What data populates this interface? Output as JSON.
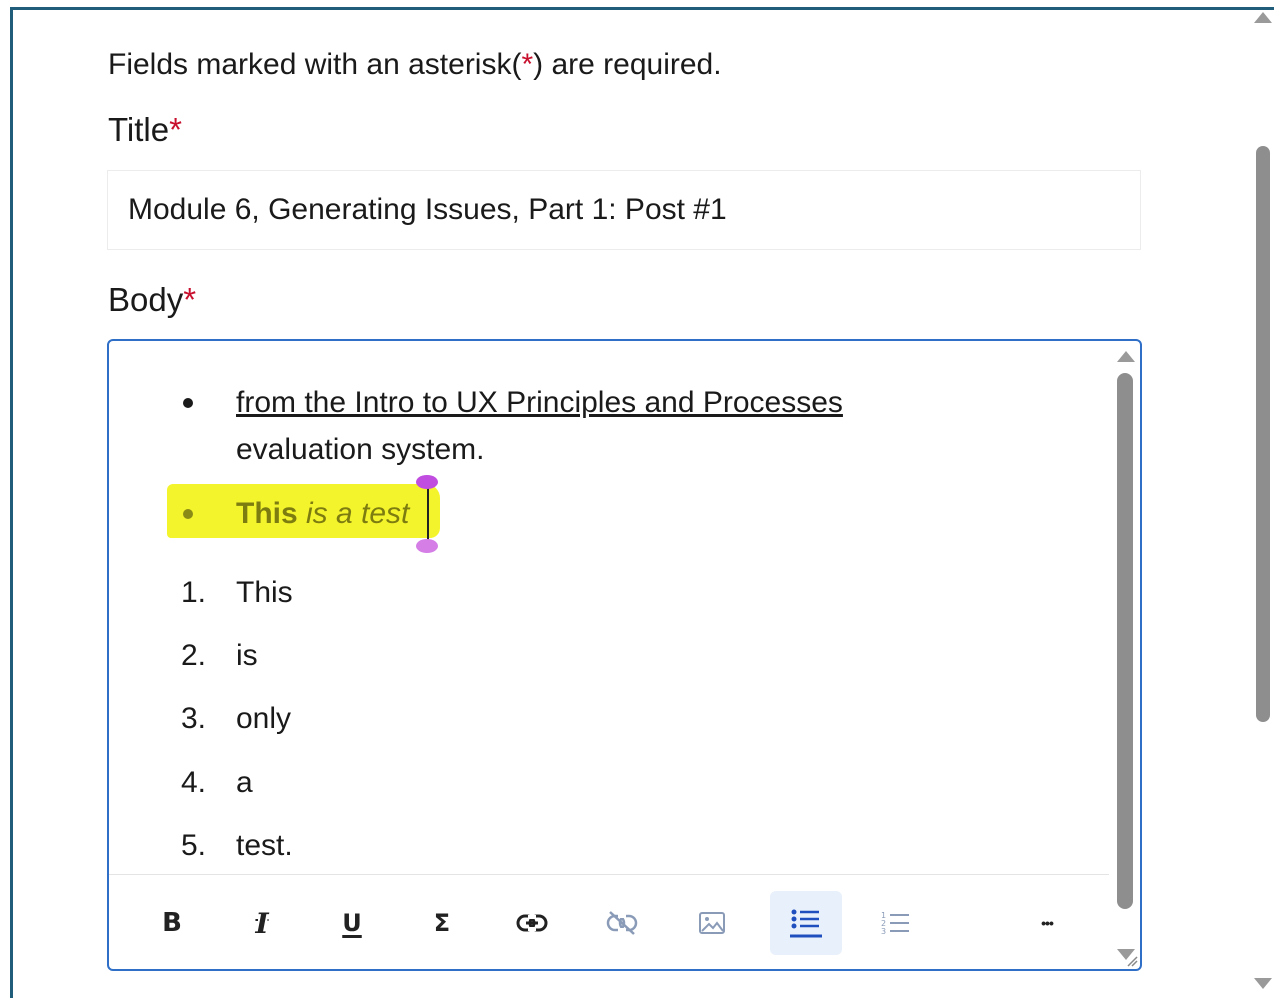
{
  "form": {
    "required_note_prefix": "Fields marked with an asterisk(",
    "required_note_star": "*",
    "required_note_suffix": ") are required.",
    "title_label": "Title",
    "title_star": "*",
    "title_value": "Module 6, Generating Issues, Part 1: Post #1",
    "body_label": "Body",
    "body_star": "*"
  },
  "editor": {
    "bullet_1_link": "from the Intro to UX Principles and Processes",
    "bullet_1_rest": "evaluation system.",
    "bullet_2_bold": "This",
    "bullet_2_italic": " is a test",
    "numbered_items": [
      {
        "num": "1.",
        "text": "This"
      },
      {
        "num": "2.",
        "text": "is"
      },
      {
        "num": "3.",
        "text": "only"
      },
      {
        "num": "4.",
        "text": "a"
      },
      {
        "num": "5.",
        "text": "test."
      }
    ]
  },
  "toolbar": {
    "buttons": [
      {
        "name": "bold",
        "icon": "bold-icon",
        "glyph": "B",
        "state": "enabled"
      },
      {
        "name": "italic",
        "icon": "italic-icon",
        "glyph": "I",
        "state": "enabled"
      },
      {
        "name": "underline",
        "icon": "underline-icon",
        "glyph": "U",
        "state": "enabled"
      },
      {
        "name": "equation",
        "icon": "sigma-icon",
        "glyph": "Σ",
        "state": "enabled"
      },
      {
        "name": "link",
        "icon": "link-icon",
        "state": "enabled"
      },
      {
        "name": "unlink",
        "icon": "unlink-icon",
        "state": "disabled"
      },
      {
        "name": "image",
        "icon": "image-icon",
        "state": "disabled"
      },
      {
        "name": "bulleted-list",
        "icon": "bulleted-list-icon",
        "state": "active"
      },
      {
        "name": "numbered-list",
        "icon": "numbered-list-icon",
        "state": "disabled"
      },
      {
        "name": "more",
        "icon": "more-icon",
        "glyph": "•••",
        "state": "enabled"
      }
    ]
  },
  "colors": {
    "frame_border": "#1f5d7a",
    "editor_border": "#2f6fc8",
    "required_star": "#c8102e",
    "highlight": "#f4f42c",
    "active_button_bg": "#e8f0fb",
    "active_button_accent": "#1f4fbf",
    "selection_handle": "#d47ee6"
  }
}
